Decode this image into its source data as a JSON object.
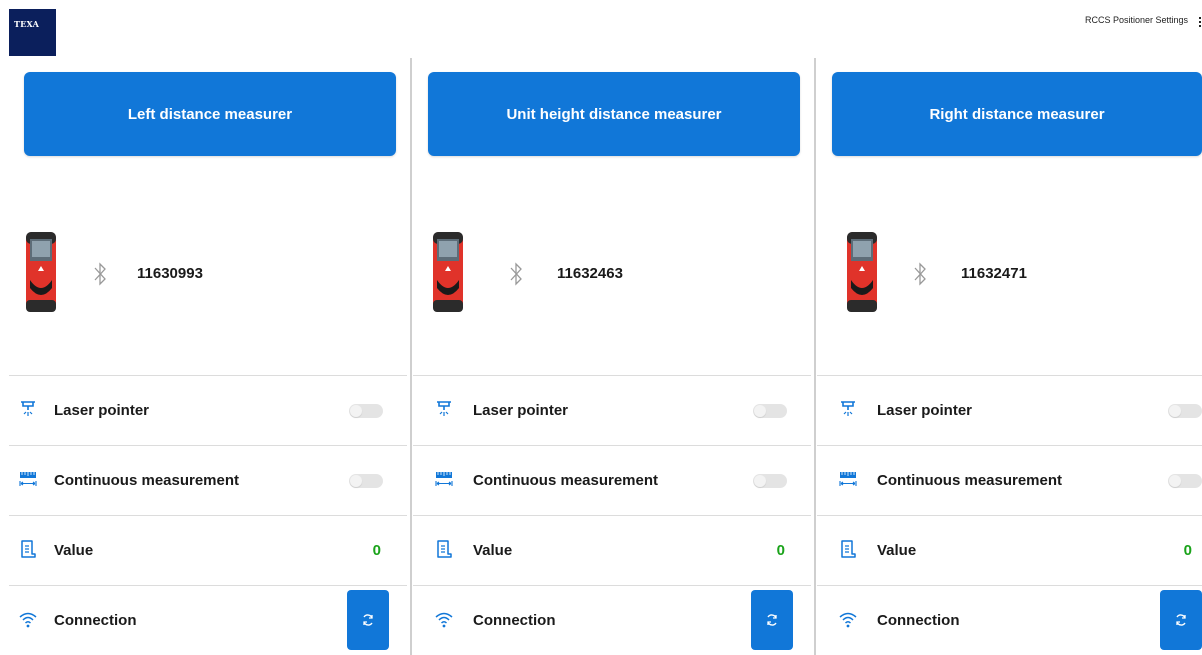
{
  "app": {
    "logo_text": "TEXA",
    "settings_title": "RCCS Positioner Settings"
  },
  "colors": {
    "accent": "#1177d8",
    "value_green": "#1aa31a",
    "logo_bg": "#0b1f5c",
    "device_red": "#e0332a"
  },
  "panels": [
    {
      "title": "Left distance measurer",
      "serial": "11630993",
      "rows": {
        "laser_pointer": "Laser pointer",
        "continuous_measurement": "Continuous measurement",
        "value_label": "Value",
        "value": "0",
        "connection": "Connection"
      }
    },
    {
      "title": "Unit height distance measurer",
      "serial": "11632463",
      "rows": {
        "laser_pointer": "Laser pointer",
        "continuous_measurement": "Continuous measurement",
        "value_label": "Value",
        "value": "0",
        "connection": "Connection"
      }
    },
    {
      "title": "Right distance measurer",
      "serial": "11632471",
      "rows": {
        "laser_pointer": "Laser pointer",
        "continuous_measurement": "Continuous measurement",
        "value_label": "Value",
        "value": "0",
        "connection": "Connection"
      }
    }
  ],
  "icons": {
    "device": "laser-distance-meter-icon",
    "bluetooth": "bluetooth-icon",
    "laser": "laser-pointer-icon",
    "continuous": "continuous-measurement-icon",
    "value": "document-icon",
    "connection": "wifi-icon",
    "refresh": "refresh-icon"
  },
  "toggles": {
    "laser_pointer_on": false,
    "continuous_measurement_on": false
  }
}
